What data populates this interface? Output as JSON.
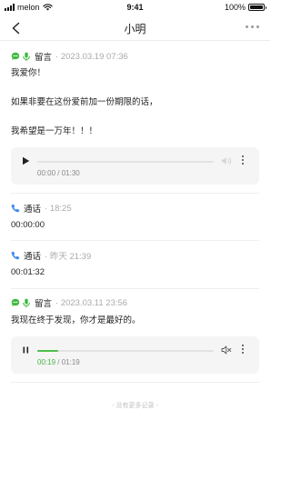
{
  "status_bar": {
    "carrier": "melon",
    "time": "9:41",
    "battery": "100%"
  },
  "nav": {
    "title": "小明"
  },
  "records": [
    {
      "type": "留言",
      "time": "2023.03.19 07:36",
      "lines": [
        "我爱你！",
        "如果非要在这份爱前加一份期限的话，",
        "我希望是一万年！！！"
      ],
      "player": {
        "current": "00:00",
        "separator": "/",
        "total": "01:30",
        "state": "paused",
        "progress": 0
      }
    },
    {
      "type": "通话",
      "time": "18:25",
      "duration": "00:00:00"
    },
    {
      "type": "通话",
      "time": "昨天 21:39",
      "duration": "00:01:32"
    },
    {
      "type": "留言",
      "time": "2023.03.11 23:56",
      "lines": [
        "我现在终于发现，你才是最好的。"
      ],
      "player": {
        "current": "00:19",
        "separator": "/",
        "total": "01:19",
        "state": "playing",
        "progress": 0.12
      }
    }
  ],
  "footer": {
    "end_note": "- 没有更多记录 -"
  },
  "colors": {
    "message_icon": "#3fb83f",
    "call_icon": "#3b8ee8",
    "progress": "#4dbf4d"
  }
}
